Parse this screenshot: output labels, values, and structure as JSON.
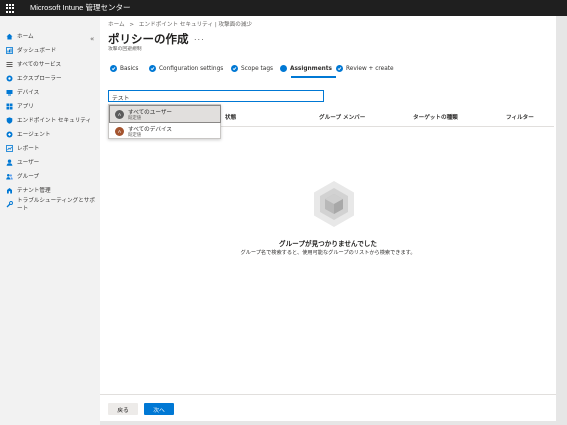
{
  "app": {
    "title": "Microsoft Intune 管理センター"
  },
  "sidebar": {
    "collapse_glyph": "«",
    "items": [
      {
        "label": "ホーム",
        "icon": "home-icon"
      },
      {
        "label": "ダッシュボード",
        "icon": "dashboard-icon"
      },
      {
        "label": "すべてのサービス",
        "icon": "list-icon"
      },
      {
        "label": "エクスプローラー",
        "icon": "explorer-icon"
      },
      {
        "label": "デバイス",
        "icon": "device-icon"
      },
      {
        "label": "アプリ",
        "icon": "apps-icon"
      },
      {
        "label": "エンドポイント セキュリティ",
        "icon": "shield-icon"
      },
      {
        "label": "エージェント",
        "icon": "agent-icon"
      },
      {
        "label": "レポート",
        "icon": "report-icon"
      },
      {
        "label": "ユーザー",
        "icon": "user-icon"
      },
      {
        "label": "グループ",
        "icon": "group-icon"
      },
      {
        "label": "テナント管理",
        "icon": "tenant-icon"
      },
      {
        "label": "トラブルシューティングとサポート",
        "icon": "wrench-icon"
      }
    ]
  },
  "breadcrumb": {
    "items": [
      "ホーム",
      "エンドポイント セキュリティ | 攻撃面の減少"
    ],
    "separator": ">"
  },
  "page": {
    "title": "ポリシーの作成",
    "more": "...",
    "subtitle": "攻撃の回避規制"
  },
  "steps": [
    {
      "label": "Basics",
      "state": "done"
    },
    {
      "label": "Configuration settings",
      "state": "done"
    },
    {
      "label": "Scope tags",
      "state": "done"
    },
    {
      "label": "Assignments",
      "state": "current"
    },
    {
      "label": "Review + create",
      "state": "done"
    }
  ],
  "search": {
    "value": "テスト"
  },
  "table": {
    "columns": [
      "状態",
      "グループ メンバー",
      "ターゲットの種類",
      "フィルター"
    ]
  },
  "dropdown": {
    "items": [
      {
        "name": "すべてのユーザー",
        "sub": "既定値",
        "initial": "A",
        "color": "#5c5c5c"
      },
      {
        "name": "すべてのデバイス",
        "sub": "既定値",
        "initial": "A",
        "color": "#a4542f"
      }
    ]
  },
  "empty": {
    "title": "グループが見つかりませんでした",
    "description": "グループ名で検索すると、使用可能なグループのリストから検索できます。"
  },
  "footer": {
    "back_label": "戻る",
    "next_label": "次へ"
  },
  "colors": {
    "accent": "#0078d4",
    "topbar": "#1f1f1f",
    "sidebar": "#f2f2f2"
  }
}
